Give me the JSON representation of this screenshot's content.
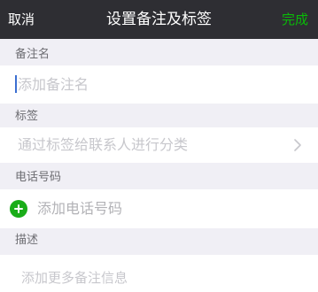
{
  "navbar": {
    "cancel_label": "取消",
    "title": "设置备注及标签",
    "done_label": "完成"
  },
  "remark": {
    "section_label": "备注名",
    "placeholder": "添加备注名"
  },
  "tags": {
    "section_label": "标签",
    "placeholder": "通过标签给联系人进行分类",
    "chevron_icon": "chevron-right-icon"
  },
  "phone": {
    "section_label": "电话号码",
    "add_label": "添加电话号码",
    "add_icon": "plus-circle-icon"
  },
  "description": {
    "section_label": "描述",
    "placeholder": "添加更多备注信息"
  },
  "colors": {
    "navbar_bg": "#2e2e33",
    "accent_green": "#09bb07",
    "add_icon_green": "#1aad19",
    "page_bg": "#f0eff5",
    "placeholder": "#c7c7cc",
    "section_label": "#6d6d72"
  }
}
